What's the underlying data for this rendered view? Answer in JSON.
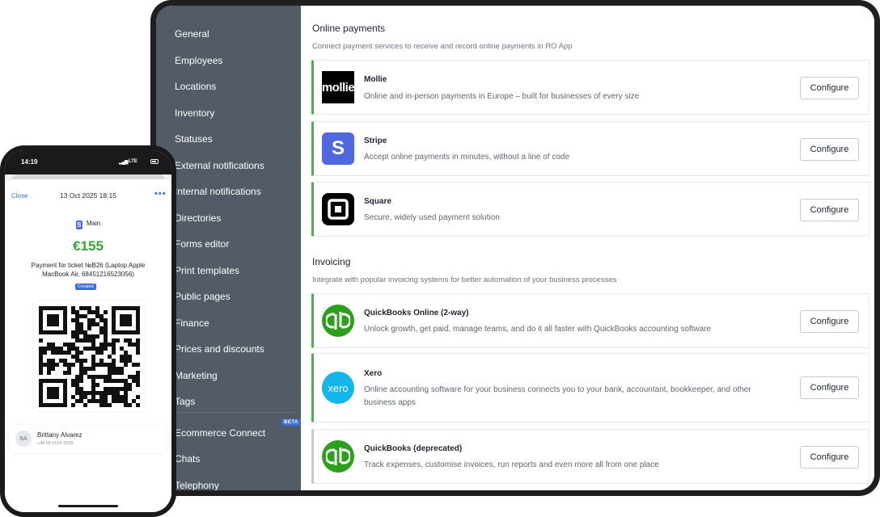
{
  "sidebar": {
    "items": [
      {
        "label": "General"
      },
      {
        "label": "Employees"
      },
      {
        "label": "Locations"
      },
      {
        "label": "Inventory"
      },
      {
        "label": "Statuses"
      },
      {
        "label": "External notifications"
      },
      {
        "label": "Internal notifications"
      },
      {
        "label": "Directories"
      },
      {
        "label": "Forms editor"
      },
      {
        "label": "Print templates"
      },
      {
        "label": "Public pages"
      },
      {
        "label": "Finance"
      },
      {
        "label": "Prices and discounts"
      },
      {
        "label": "Marketing"
      },
      {
        "label": "Tags"
      },
      {
        "label": "Ecommerce Connect",
        "badge": "BETA"
      },
      {
        "label": "Chats"
      },
      {
        "label": "Telephony"
      }
    ]
  },
  "online_payments": {
    "title": "Online payments",
    "subtitle": "Connect payment services to receive and record online payments in RO App",
    "providers": [
      {
        "name": "Mollie",
        "description": "Online and in-person payments in Europe – built for businesses of every size",
        "logo_text": "mollie",
        "button": "Configure",
        "accent": "#4caf50"
      },
      {
        "name": "Stripe",
        "description": "Accept online payments in minutes, without a line of code",
        "logo_text": "S",
        "button": "Configure",
        "accent": "#4caf50"
      },
      {
        "name": "Square",
        "description": "Secure, widely used payment solution",
        "button": "Configure",
        "accent": "#4caf50"
      }
    ]
  },
  "invoicing": {
    "title": "Invoicing",
    "subtitle": "Integrate with popular invoicing systems for better automation of your business processes",
    "providers": [
      {
        "name": "QuickBooks Online (2-way)",
        "description": "Unlock growth, get paid, manage teams, and do it all faster with QuickBooks accounting software",
        "button": "Configure",
        "accent": "#4caf50"
      },
      {
        "name": "Xero",
        "description": "Online accounting software for your business connects you to your bank, accountant, bookkeeper, and other business apps",
        "logo_text": "xero",
        "button": "Configure",
        "accent": "#4caf50"
      },
      {
        "name": "QuickBooks (deprecated)",
        "description": "Track expenses, customise invoices, run reports and even more all from one place",
        "button": "Configure",
        "accent": "#c4c7cc"
      }
    ]
  },
  "phone": {
    "status_time": "14:19",
    "network": "LTE",
    "close": "Close",
    "date": "13 Oct 2025 18:15",
    "more": "•••",
    "store_icon": "S",
    "store": "Main",
    "amount": "€155",
    "description": "Payment for ticket №B26 (Laptop Apple MacBook Air, 68451216523056)",
    "badge": "Created",
    "contact": {
      "initials": "BA",
      "name": "Brittany Alvarez",
      "phone": "+44 55 6526 9039"
    }
  }
}
